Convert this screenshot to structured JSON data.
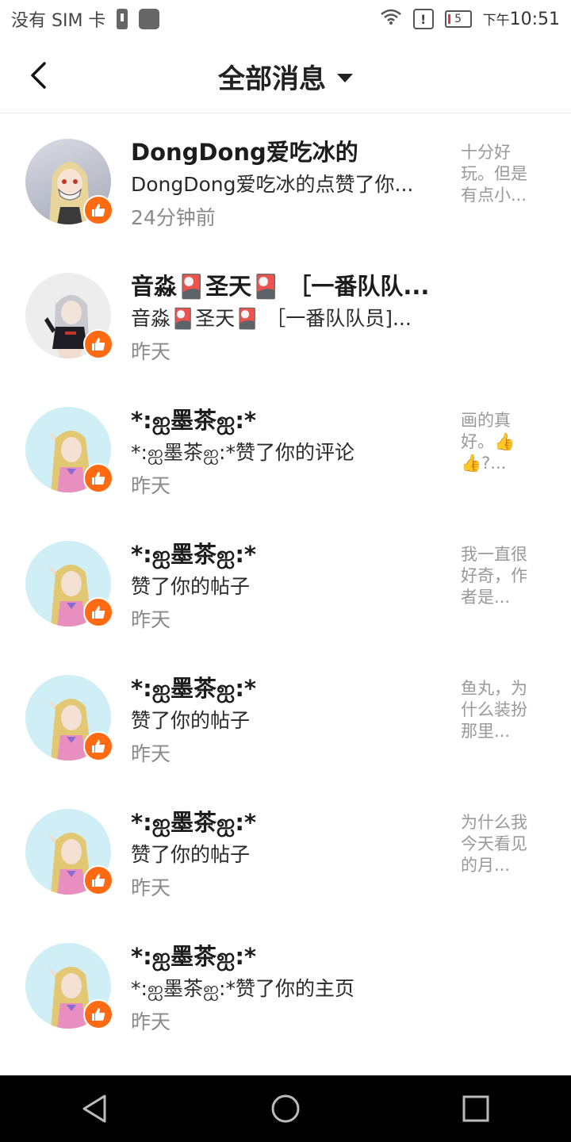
{
  "status_bar": {
    "carrier": "没有 SIM 卡",
    "battery_level": "5",
    "time_prefix": "下午",
    "time": "10:51"
  },
  "header": {
    "title": "全部消息"
  },
  "colors": {
    "like_badge": "#ff6a13",
    "preview_text": "#999999",
    "time_text": "#8a8a8a"
  },
  "messages": [
    {
      "name": "DongDong爱吃冰的",
      "desc": "DongDong爱吃冰的点赞了你...",
      "time": "24分钟前",
      "preview": "十分好玩。但是有点小...",
      "icon": "like-icon"
    },
    {
      "name": "音淼🎴圣天🎴 ［一番队队...",
      "desc": "音淼🎴圣天🎴 ［一番队队员]...",
      "time": "昨天",
      "preview": "",
      "icon": "like-icon"
    },
    {
      "name": "*:ஐ墨茶ஐ:*",
      "desc": "*:ஐ墨茶ஐ:*赞了你的评论",
      "time": "昨天",
      "preview": "画的真好。👍👍?...",
      "icon": "like-icon"
    },
    {
      "name": "*:ஐ墨茶ஐ:*",
      "desc": "赞了你的帖子",
      "time": "昨天",
      "preview": "我一直很好奇，作者是...",
      "icon": "like-icon"
    },
    {
      "name": "*:ஐ墨茶ஐ:*",
      "desc": "赞了你的帖子",
      "time": "昨天",
      "preview": "鱼丸，为什么装扮那里...",
      "icon": "like-icon"
    },
    {
      "name": "*:ஐ墨茶ஐ:*",
      "desc": "赞了你的帖子",
      "time": "昨天",
      "preview": "为什么我今天看见的月...",
      "icon": "like-icon"
    },
    {
      "name": "*:ஐ墨茶ஐ:*",
      "desc": "*:ஐ墨茶ஐ:*赞了你的主页",
      "time": "昨天",
      "preview": "",
      "icon": "like-icon"
    }
  ]
}
